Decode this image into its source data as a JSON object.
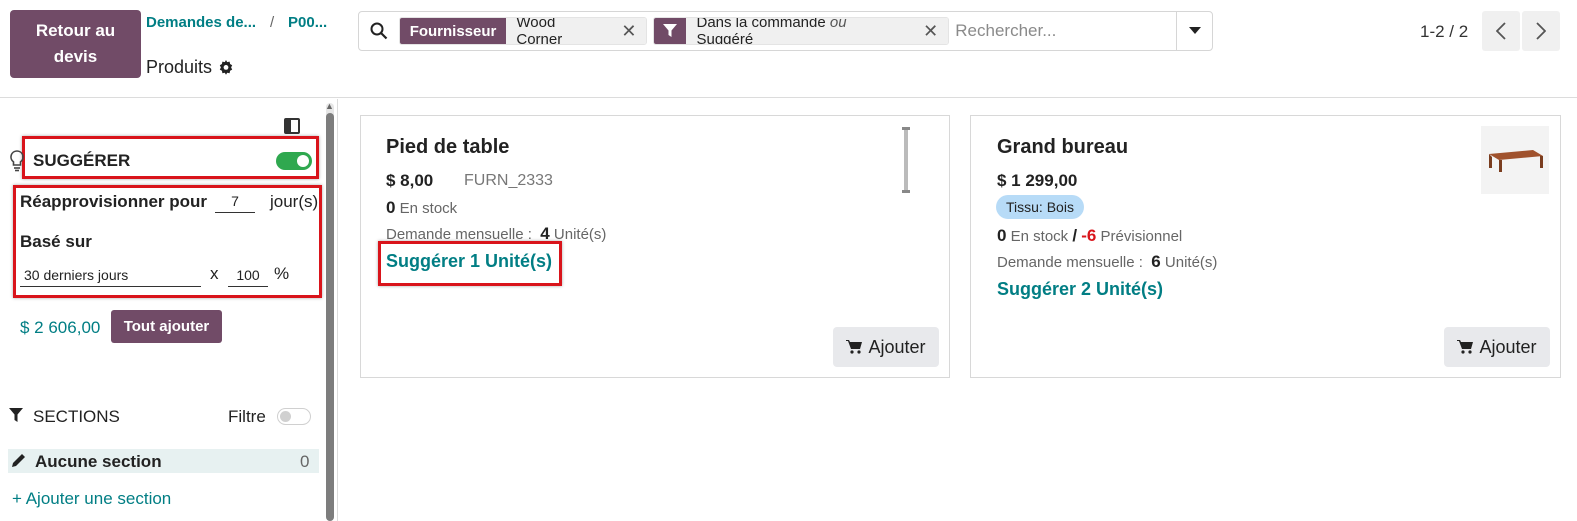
{
  "header": {
    "back_button": "Retour au devis",
    "breadcrumb_1": "Demandes de...",
    "breadcrumb_sep": "/",
    "breadcrumb_2": "P00...",
    "page_title": "Produits"
  },
  "search": {
    "facet1_label": "Fournisseur",
    "facet1_value": "Wood Corner",
    "facet2_value_a": "Dans la commande",
    "facet2_or": "ou",
    "facet2_value_b": "Suggéré",
    "placeholder": "Rechercher..."
  },
  "pager": {
    "text": "1-2 / 2"
  },
  "sidebar": {
    "suggest_label": "SUGGÉRER",
    "suggest_enabled": true,
    "reappro_label": "Réapprovisionner pour",
    "reappro_days": "7",
    "days_unit": "jour(s)",
    "based_on_label": "Basé sur",
    "based_on_value": "30 derniers jours",
    "multiplier_sign": "x",
    "percent_value": "100",
    "percent_sign": "%",
    "total": "$ 2 606,00",
    "add_all_button": "Tout ajouter",
    "sections_label": "SECTIONS",
    "filter_label": "Filtre",
    "filter_enabled": false,
    "section_name": "Aucune section",
    "section_count": "0",
    "add_section": "+ Ajouter une section"
  },
  "products": [
    {
      "name": "Pied de table",
      "price": "$ 8,00",
      "ref": "FURN_2333",
      "stock_qty": "0",
      "stock_label": "En stock",
      "demand_label": "Demande mensuelle :",
      "demand_qty": "4",
      "demand_unit": "Unité(s)",
      "suggest": "Suggérer 1 Unité(s)",
      "add_button": "Ajouter"
    },
    {
      "name": "Grand bureau",
      "price": "$ 1 299,00",
      "badge": "Tissu: Bois",
      "stock_qty": "0",
      "stock_label": "En stock",
      "stock_sep": "/",
      "forecast_qty": "-6",
      "forecast_label": "Prévisionnel",
      "demand_label": "Demande mensuelle :",
      "demand_qty": "6",
      "demand_unit": "Unité(s)",
      "suggest": "Suggérer 2 Unité(s)",
      "add_button": "Ajouter"
    }
  ],
  "colors": {
    "primary": "#714b67",
    "link": "#017e84",
    "highlight": "#d9141b",
    "toggle_on": "#2fa84f"
  }
}
